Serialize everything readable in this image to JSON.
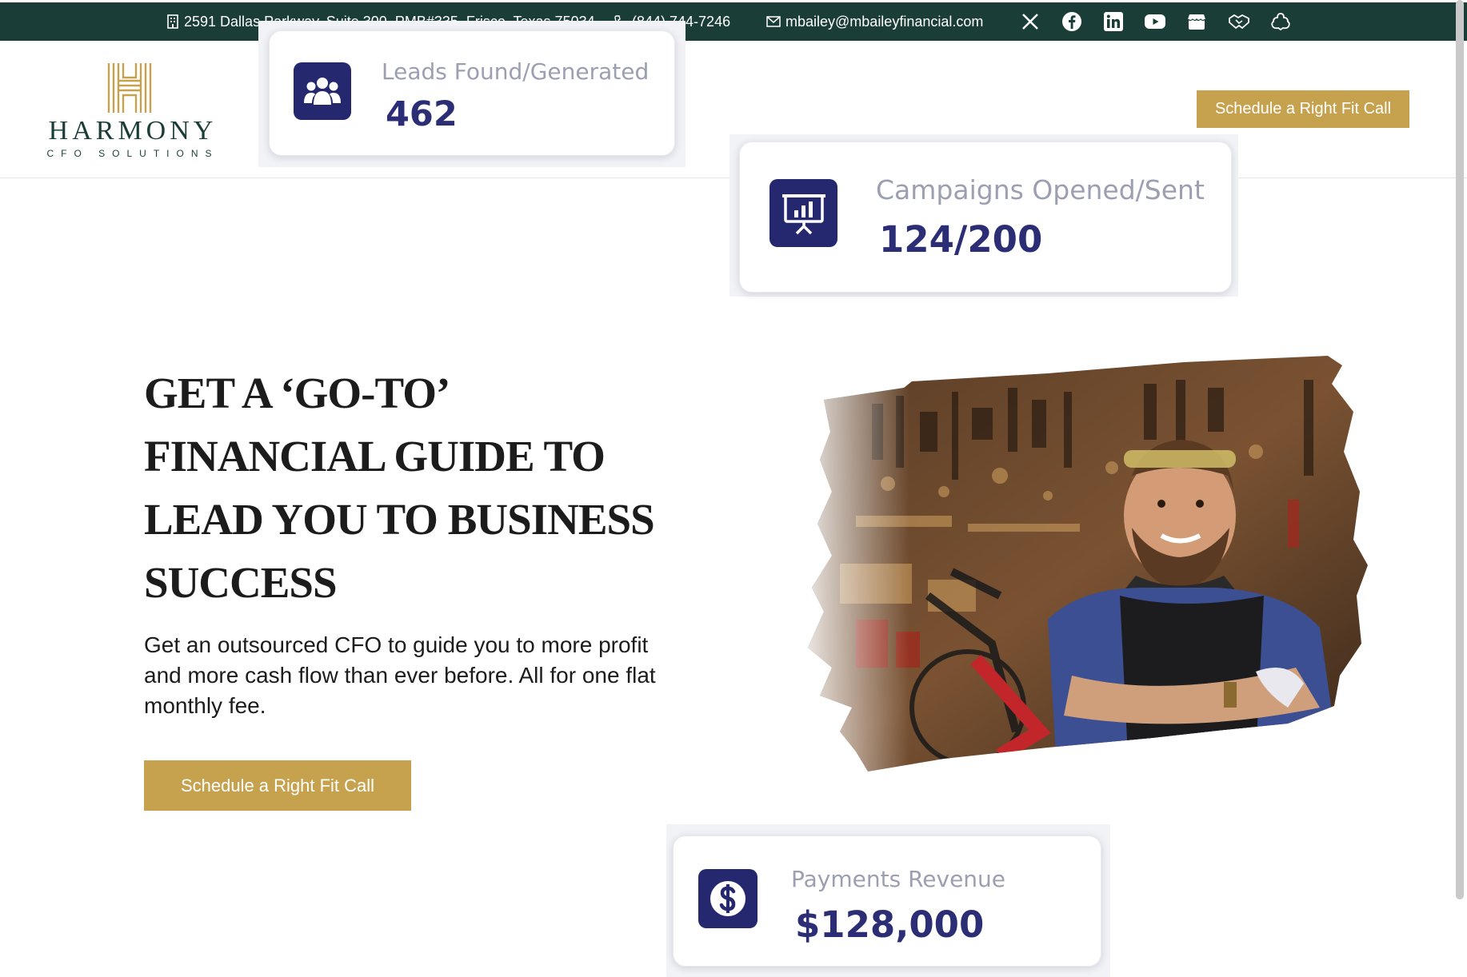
{
  "topbar": {
    "address": "2591 Dallas Parkway, Suite 300, PMB#335, Frisco, Texas 75034",
    "phone": "(844) 744-7246",
    "email": "mbailey@mbaileyfinancial.com",
    "social_icons": [
      "x-icon",
      "facebook-icon",
      "linkedin-icon",
      "youtube-icon",
      "store-icon",
      "handshake-icon",
      "cloud-icon"
    ]
  },
  "header": {
    "logo_word": "HARMONY",
    "logo_sub": "CFO SOLUTIONS",
    "cta_label": "Schedule a Right Fit Call"
  },
  "stats": {
    "leads": {
      "label": "Leads Found/Generated",
      "value": "462",
      "icon": "users-icon"
    },
    "campaigns": {
      "label": "Campaigns Opened/Sent",
      "value": "124/200",
      "icon": "presentation-chart-icon"
    },
    "payments": {
      "label": "Payments Revenue",
      "value": "$128,000",
      "icon": "dollar-icon"
    }
  },
  "hero": {
    "headline": "GET A ‘GO-TO’ FINANCIAL GUIDE TO LEAD YOU TO BUSINESS SUCCESS",
    "subcopy": "Get an outsourced CFO to guide you to more profit and more cash flow than ever before. All for one flat monthly fee.",
    "cta_label": "Schedule a Right Fit Call"
  },
  "colors": {
    "topbar": "#1b3d37",
    "accent_gold": "#c6a24f",
    "badge_navy": "#25286e",
    "stat_value": "#2b2e74",
    "stat_label": "#9c9fb1"
  }
}
